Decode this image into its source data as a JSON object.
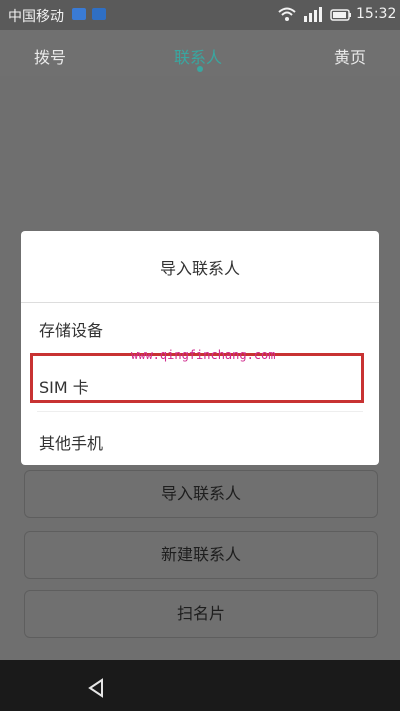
{
  "status_bar": {
    "carrier": "中国移动",
    "time": "15:32",
    "icons": [
      "notification-icon",
      "notification-icon",
      "wifi-icon",
      "signal-icon",
      "battery-icon"
    ]
  },
  "tabs": [
    {
      "label": "拨号"
    },
    {
      "label": "联系人",
      "active": true
    },
    {
      "label": "黄页"
    }
  ],
  "dialog": {
    "title": "导入联系人",
    "options": [
      {
        "label": "存储设备"
      },
      {
        "label": "SIM 卡",
        "highlighted": true
      },
      {
        "label": "其他手机"
      }
    ],
    "watermark": "www.qingfinchang.com"
  },
  "background_buttons": [
    {
      "label": "导入联系人"
    },
    {
      "label": "新建联系人"
    },
    {
      "label": "扫名片"
    }
  ],
  "colors": {
    "accent": "#3aa6a0",
    "highlight_border": "#c83232",
    "watermark": "#d12a8e"
  },
  "nav_bar": {
    "icons": [
      "back-icon"
    ]
  }
}
